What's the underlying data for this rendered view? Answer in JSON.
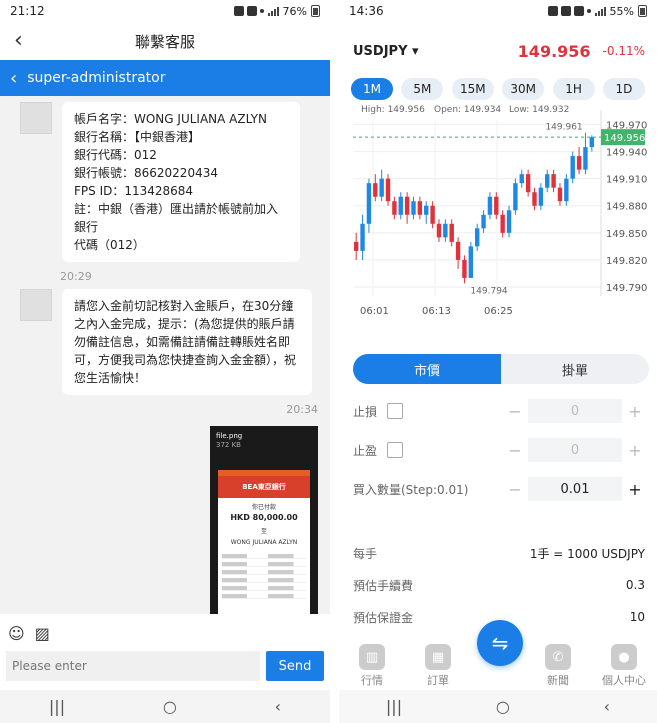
{
  "left": {
    "status": {
      "time": "21:12",
      "battery": "76%"
    },
    "header": {
      "back_icon": "‹",
      "title": "聯繫客服"
    },
    "agent_bar": {
      "chevron": "‹",
      "name": "super-administrator"
    },
    "messages": {
      "m1_lines": [
        "帳戶名字：WONG JULIANA AZLYN",
        "銀行名稱：【中銀香港】",
        "銀行代碼：012",
        "銀行帳號：86620220434",
        "FPS ID：113428684",
        "註：中銀（香港）匯出請於帳號前加入銀行",
        "代碼（012）"
      ],
      "ts1": "20:29",
      "m2_text": "請您入金前切記核對入金賬戶，在30分鐘之內入金完成，提示：(為您提供的賬戶請勿備註信息，如需備註請備註轉賬姓名即可，方便我司為您快捷查詢入金金額），祝您生活愉快！",
      "ts2": "20:34",
      "image": {
        "file_name": "file.png",
        "file_size": "372 KB",
        "bank": "BEA東亞銀行",
        "paid_label": "你已付款",
        "amount": "HKD 80,000.00",
        "to_label": "至",
        "payee": "WONG JULIANA AZLYN"
      }
    },
    "input": {
      "placeholder": "Please enter",
      "send": "Send"
    },
    "tools": {
      "emoji": "☺",
      "image": "▨"
    },
    "nav": {
      "recents": "|||",
      "home": "○",
      "back": "‹"
    }
  },
  "right": {
    "status": {
      "time": "14:36",
      "battery": "55%"
    },
    "symbol": "USDJPY ▾",
    "price": "149.956",
    "change": "-0.11%",
    "timeframes": [
      "1M",
      "5M",
      "15M",
      "30M",
      "1H",
      "1D"
    ],
    "active_timeframe": "1M",
    "chart_data": {
      "type": "candlestick",
      "high_label": "High: 149.956",
      "open_label": "Open: 149.934",
      "low_label": "Low: 149.932",
      "max_marker": "149.961",
      "min_marker": "149.794",
      "current_price": "149.956",
      "y_ticks": [
        "149.970",
        "149.940",
        "149.910",
        "149.880",
        "149.850",
        "149.820",
        "149.790"
      ],
      "x_ticks": [
        "06:01",
        "06:13",
        "06:25"
      ],
      "ylim": [
        149.78,
        149.975
      ],
      "candles": [
        [
          149.84,
          149.83,
          149.85,
          149.82
        ],
        [
          149.83,
          149.86,
          149.87,
          149.82
        ],
        [
          149.86,
          149.905,
          149.91,
          149.85
        ],
        [
          149.905,
          149.89,
          149.915,
          149.885
        ],
        [
          149.89,
          149.91,
          149.92,
          149.885
        ],
        [
          149.91,
          149.885,
          149.915,
          149.88
        ],
        [
          149.885,
          149.87,
          149.89,
          149.865
        ],
        [
          149.87,
          149.89,
          149.895,
          149.865
        ],
        [
          149.89,
          149.87,
          149.895,
          149.86
        ],
        [
          149.87,
          149.885,
          149.89,
          149.865
        ],
        [
          149.885,
          149.87,
          149.89,
          149.865
        ],
        [
          149.87,
          149.88,
          149.885,
          149.86
        ],
        [
          149.88,
          149.86,
          149.885,
          149.855
        ],
        [
          149.86,
          149.845,
          149.865,
          149.84
        ],
        [
          149.845,
          149.86,
          149.865,
          149.84
        ],
        [
          149.86,
          149.84,
          149.865,
          149.835
        ],
        [
          149.84,
          149.82,
          149.845,
          149.81
        ],
        [
          149.82,
          149.8,
          149.825,
          149.794
        ],
        [
          149.8,
          149.835,
          149.84,
          149.8
        ],
        [
          149.835,
          149.855,
          149.86,
          149.83
        ],
        [
          149.855,
          149.87,
          149.875,
          149.85
        ],
        [
          149.87,
          149.89,
          149.895,
          149.865
        ],
        [
          149.89,
          149.87,
          149.895,
          149.865
        ],
        [
          149.87,
          149.85,
          149.875,
          149.845
        ],
        [
          149.85,
          149.875,
          149.88,
          149.845
        ],
        [
          149.875,
          149.905,
          149.91,
          149.87
        ],
        [
          149.905,
          149.915,
          149.92,
          149.9
        ],
        [
          149.915,
          149.895,
          149.92,
          149.89
        ],
        [
          149.895,
          149.88,
          149.9,
          149.875
        ],
        [
          149.88,
          149.9,
          149.905,
          149.875
        ],
        [
          149.9,
          149.915,
          149.92,
          149.895
        ],
        [
          149.915,
          149.9,
          149.92,
          149.895
        ],
        [
          149.9,
          149.885,
          149.905,
          149.88
        ],
        [
          149.885,
          149.91,
          149.915,
          149.88
        ],
        [
          149.91,
          149.935,
          149.94,
          149.905
        ],
        [
          149.935,
          149.92,
          149.945,
          149.915
        ],
        [
          149.92,
          149.945,
          149.961,
          149.915
        ],
        [
          149.945,
          149.956,
          149.958,
          149.94
        ]
      ],
      "colors": {
        "up": "#1e88e5",
        "down": "#e0323d",
        "price_line": "#3fb56c"
      }
    },
    "order_tabs": {
      "market": "市價",
      "pending": "掛單"
    },
    "stop_loss": {
      "label": "止損",
      "value": "0"
    },
    "take_profit": {
      "label": "止盈",
      "value": "0"
    },
    "quantity": {
      "label": "買入數量(Step:0.01)",
      "value": "0.01"
    },
    "info": [
      {
        "label": "每手",
        "value": "1手 = 1000 USDJPY"
      },
      {
        "label": "預估手續費",
        "value": "0.3"
      },
      {
        "label": "預估保證金",
        "value": "10"
      }
    ],
    "bottom_nav": [
      {
        "label": "行情",
        "icon": "chart-icon"
      },
      {
        "label": "訂單",
        "icon": "grid-icon"
      },
      {
        "label": "新聞",
        "icon": "phone-icon"
      },
      {
        "label": "個人中心",
        "icon": "user-icon"
      }
    ],
    "fab_icon": "⇋",
    "minus": "−",
    "plus": "+"
  }
}
